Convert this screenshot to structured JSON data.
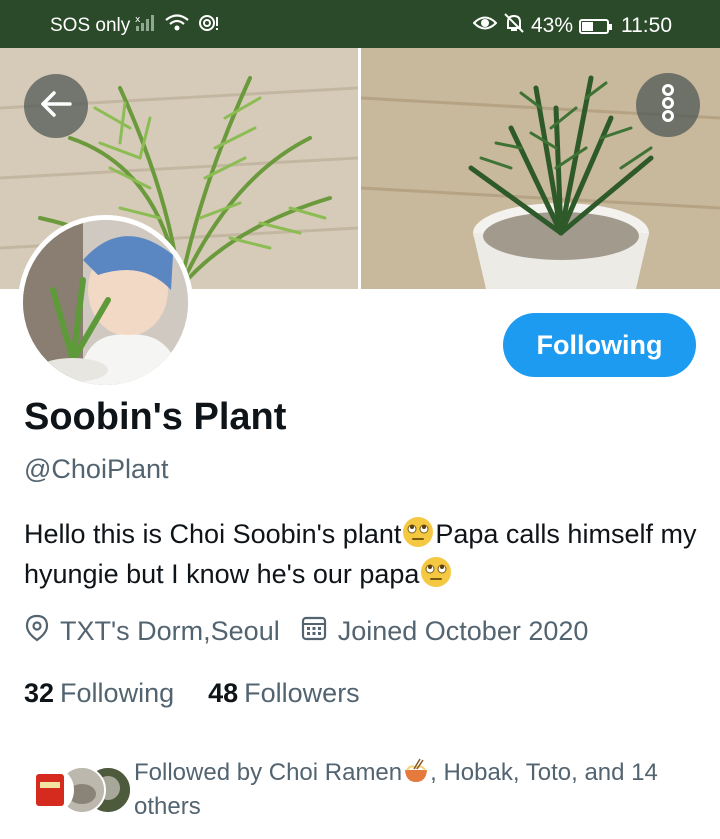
{
  "status_bar": {
    "carrier": "SOS only",
    "battery": "43%",
    "battery_level": 0.43,
    "time": "11:50"
  },
  "header": {
    "back_icon": "arrow-left-icon",
    "more_icon": "more-vertical-icon"
  },
  "profile": {
    "follow_button_label": "Following",
    "display_name": "Soobin's Plant",
    "handle": "@ChoiPlant",
    "bio_part1": "Hello this is Choi Soobin's plant",
    "bio_part2": "Papa calls himself my hyungie but I know he's our papa",
    "location": "TXT's Dorm,Seoul",
    "joined": "Joined October 2020",
    "following_count": "32",
    "following_label": "Following",
    "followers_count": "48",
    "followers_label": "Followers",
    "followed_by_part1": "Followed by Choi Ramen",
    "followed_by_part2": ", Hobak, Toto, and 14 others"
  },
  "colors": {
    "status_bar_bg": "#2a4a2a",
    "accent": "#1d9bf0",
    "secondary_text": "#536471",
    "primary_text": "#0f1419"
  }
}
